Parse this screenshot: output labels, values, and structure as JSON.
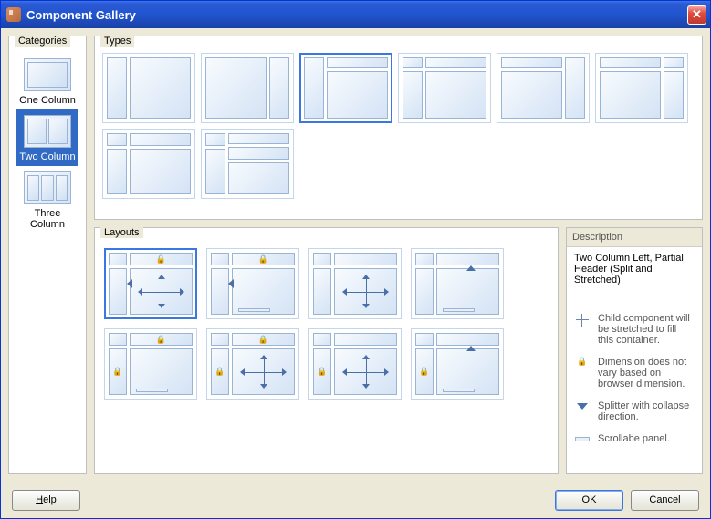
{
  "window": {
    "title": "Component Gallery"
  },
  "categories": {
    "legend": "Categories",
    "items": [
      {
        "label": "One Column",
        "cols": 1,
        "selected": false
      },
      {
        "label": "Two Column",
        "cols": 2,
        "selected": true
      },
      {
        "label": "Three Column",
        "cols": 3,
        "selected": false
      }
    ]
  },
  "types": {
    "legend": "Types",
    "items": [
      {
        "kind": "left-narrow",
        "selected": false
      },
      {
        "kind": "right-narrow",
        "selected": false
      },
      {
        "kind": "left-narrow-header",
        "selected": true
      },
      {
        "kind": "two-header-left",
        "selected": false
      },
      {
        "kind": "right-narrow-header",
        "selected": false
      },
      {
        "kind": "two-header-right",
        "selected": false
      },
      {
        "kind": "stacked-left-two",
        "selected": false
      },
      {
        "kind": "stacked-header-two",
        "selected": false
      }
    ]
  },
  "layouts": {
    "legend": "Layouts",
    "items": [
      {
        "id": 1,
        "splitLeft": true,
        "splitUp": false,
        "stretch": true,
        "scroll": false,
        "lockHdr": true,
        "lockLeft": false,
        "selected": true
      },
      {
        "id": 2,
        "splitLeft": true,
        "splitUp": false,
        "stretch": false,
        "scroll": true,
        "lockHdr": true,
        "lockLeft": false,
        "selected": false
      },
      {
        "id": 3,
        "splitLeft": false,
        "splitUp": false,
        "stretch": true,
        "scroll": false,
        "lockHdr": false,
        "lockLeft": false,
        "selected": false
      },
      {
        "id": 4,
        "splitLeft": false,
        "splitUp": true,
        "stretch": false,
        "scroll": true,
        "lockHdr": false,
        "lockLeft": false,
        "selected": false
      },
      {
        "id": 5,
        "splitLeft": false,
        "splitUp": false,
        "stretch": false,
        "scroll": true,
        "lockHdr": true,
        "lockLeft": true,
        "selected": false
      },
      {
        "id": 6,
        "splitLeft": false,
        "splitUp": false,
        "stretch": true,
        "scroll": false,
        "lockHdr": true,
        "lockLeft": true,
        "selected": false
      },
      {
        "id": 7,
        "splitLeft": false,
        "splitUp": false,
        "stretch": true,
        "scroll": false,
        "lockHdr": false,
        "lockLeft": true,
        "selected": false
      },
      {
        "id": 8,
        "splitLeft": false,
        "splitUp": true,
        "stretch": false,
        "scroll": true,
        "lockHdr": false,
        "lockLeft": true,
        "selected": false
      }
    ]
  },
  "description": {
    "legend": "Description",
    "title": "Two Column Left, Partial Header (Split and Stretched)",
    "legend_items": [
      {
        "icon": "stretch",
        "text": "Child component will be stretched to fill this container."
      },
      {
        "icon": "lock",
        "text": "Dimension does not vary based on browser dimension."
      },
      {
        "icon": "splitter",
        "text": "Splitter with collapse direction."
      },
      {
        "icon": "scroll",
        "text": "Scrollabe panel."
      }
    ]
  },
  "buttons": {
    "help": "Help",
    "ok": "OK",
    "cancel": "Cancel"
  }
}
